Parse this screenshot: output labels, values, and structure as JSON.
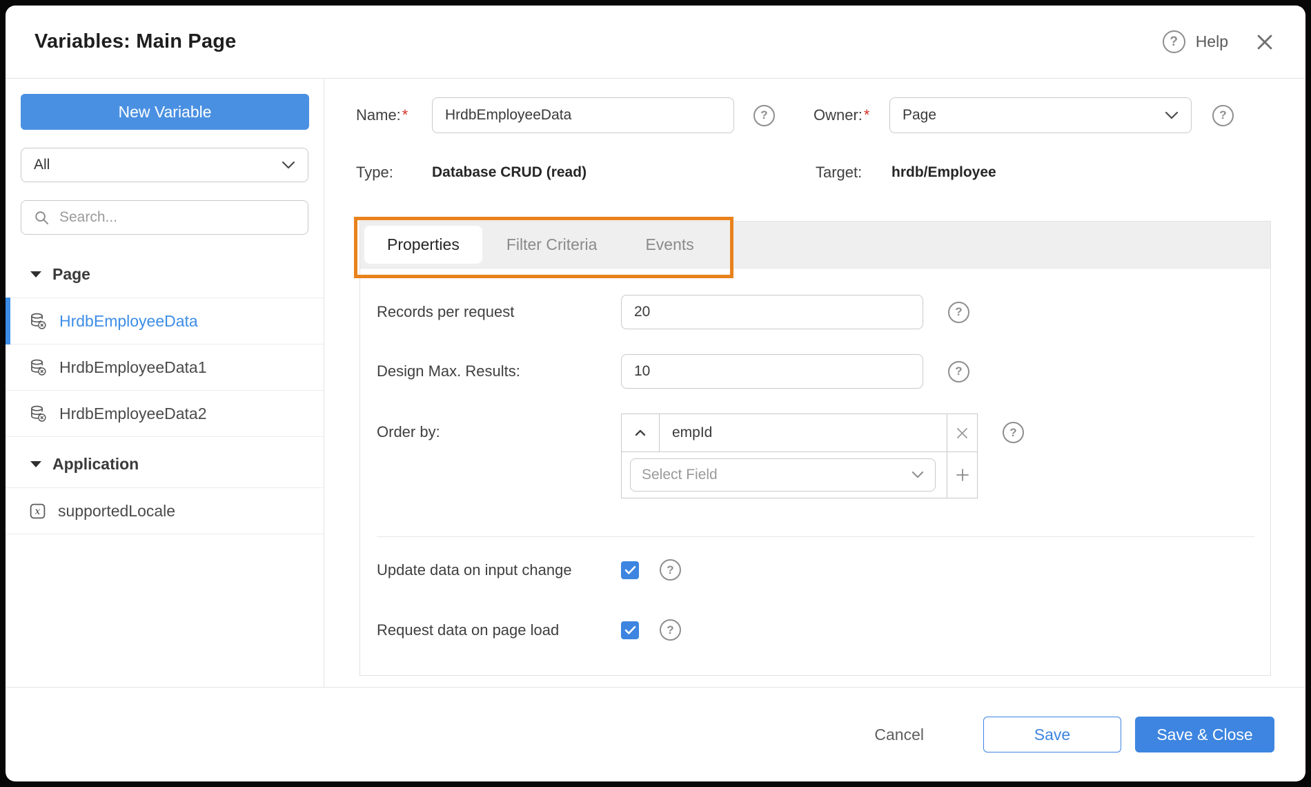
{
  "window": {
    "title": "Variables: Main Page",
    "help_label": "Help"
  },
  "sidebar": {
    "new_variable_button": "New Variable",
    "filter_select_value": "All",
    "search_placeholder": "Search...",
    "sections": [
      {
        "label": "Page",
        "items": [
          {
            "label": "HrdbEmployeeData",
            "icon": "database-crud-icon",
            "selected": true
          },
          {
            "label": "HrdbEmployeeData1",
            "icon": "database-crud-icon",
            "selected": false
          },
          {
            "label": "HrdbEmployeeData2",
            "icon": "database-crud-icon",
            "selected": false
          }
        ]
      },
      {
        "label": "Application",
        "items": [
          {
            "label": "supportedLocale",
            "icon": "expression-variable-icon",
            "selected": false
          }
        ]
      }
    ]
  },
  "details": {
    "required_marker": "*",
    "name_label": "Name:",
    "name_value": "HrdbEmployeeData",
    "owner_label": "Owner:",
    "owner_value": "Page",
    "type_label": "Type:",
    "type_value": "Database CRUD (read)",
    "target_label": "Target:",
    "target_value": "hrdb/Employee"
  },
  "tabs": {
    "active": "Properties",
    "properties": "Properties",
    "filter_criteria": "Filter Criteria",
    "events": "Events"
  },
  "properties_form": {
    "records_per_request_label": "Records per request",
    "records_per_request_value": "20",
    "design_max_results_label": "Design Max. Results:",
    "design_max_results_value": "10",
    "order_by_label": "Order by:",
    "order_by_rows": [
      {
        "field": "empId",
        "direction": "ascending"
      }
    ],
    "select_field_placeholder": "Select Field",
    "update_on_input_label": "Update data on input change",
    "update_on_input_checked": true,
    "request_on_load_label": "Request data on page load",
    "request_on_load_checked": true
  },
  "footer": {
    "cancel": "Cancel",
    "save": "Save",
    "save_and_close": "Save & Close"
  },
  "colors": {
    "accent_blue": "#4a90e2",
    "button_blue": "#3d85e0",
    "selected_item_blue": "#3c8de8",
    "highlight_orange": "#e8821c"
  }
}
